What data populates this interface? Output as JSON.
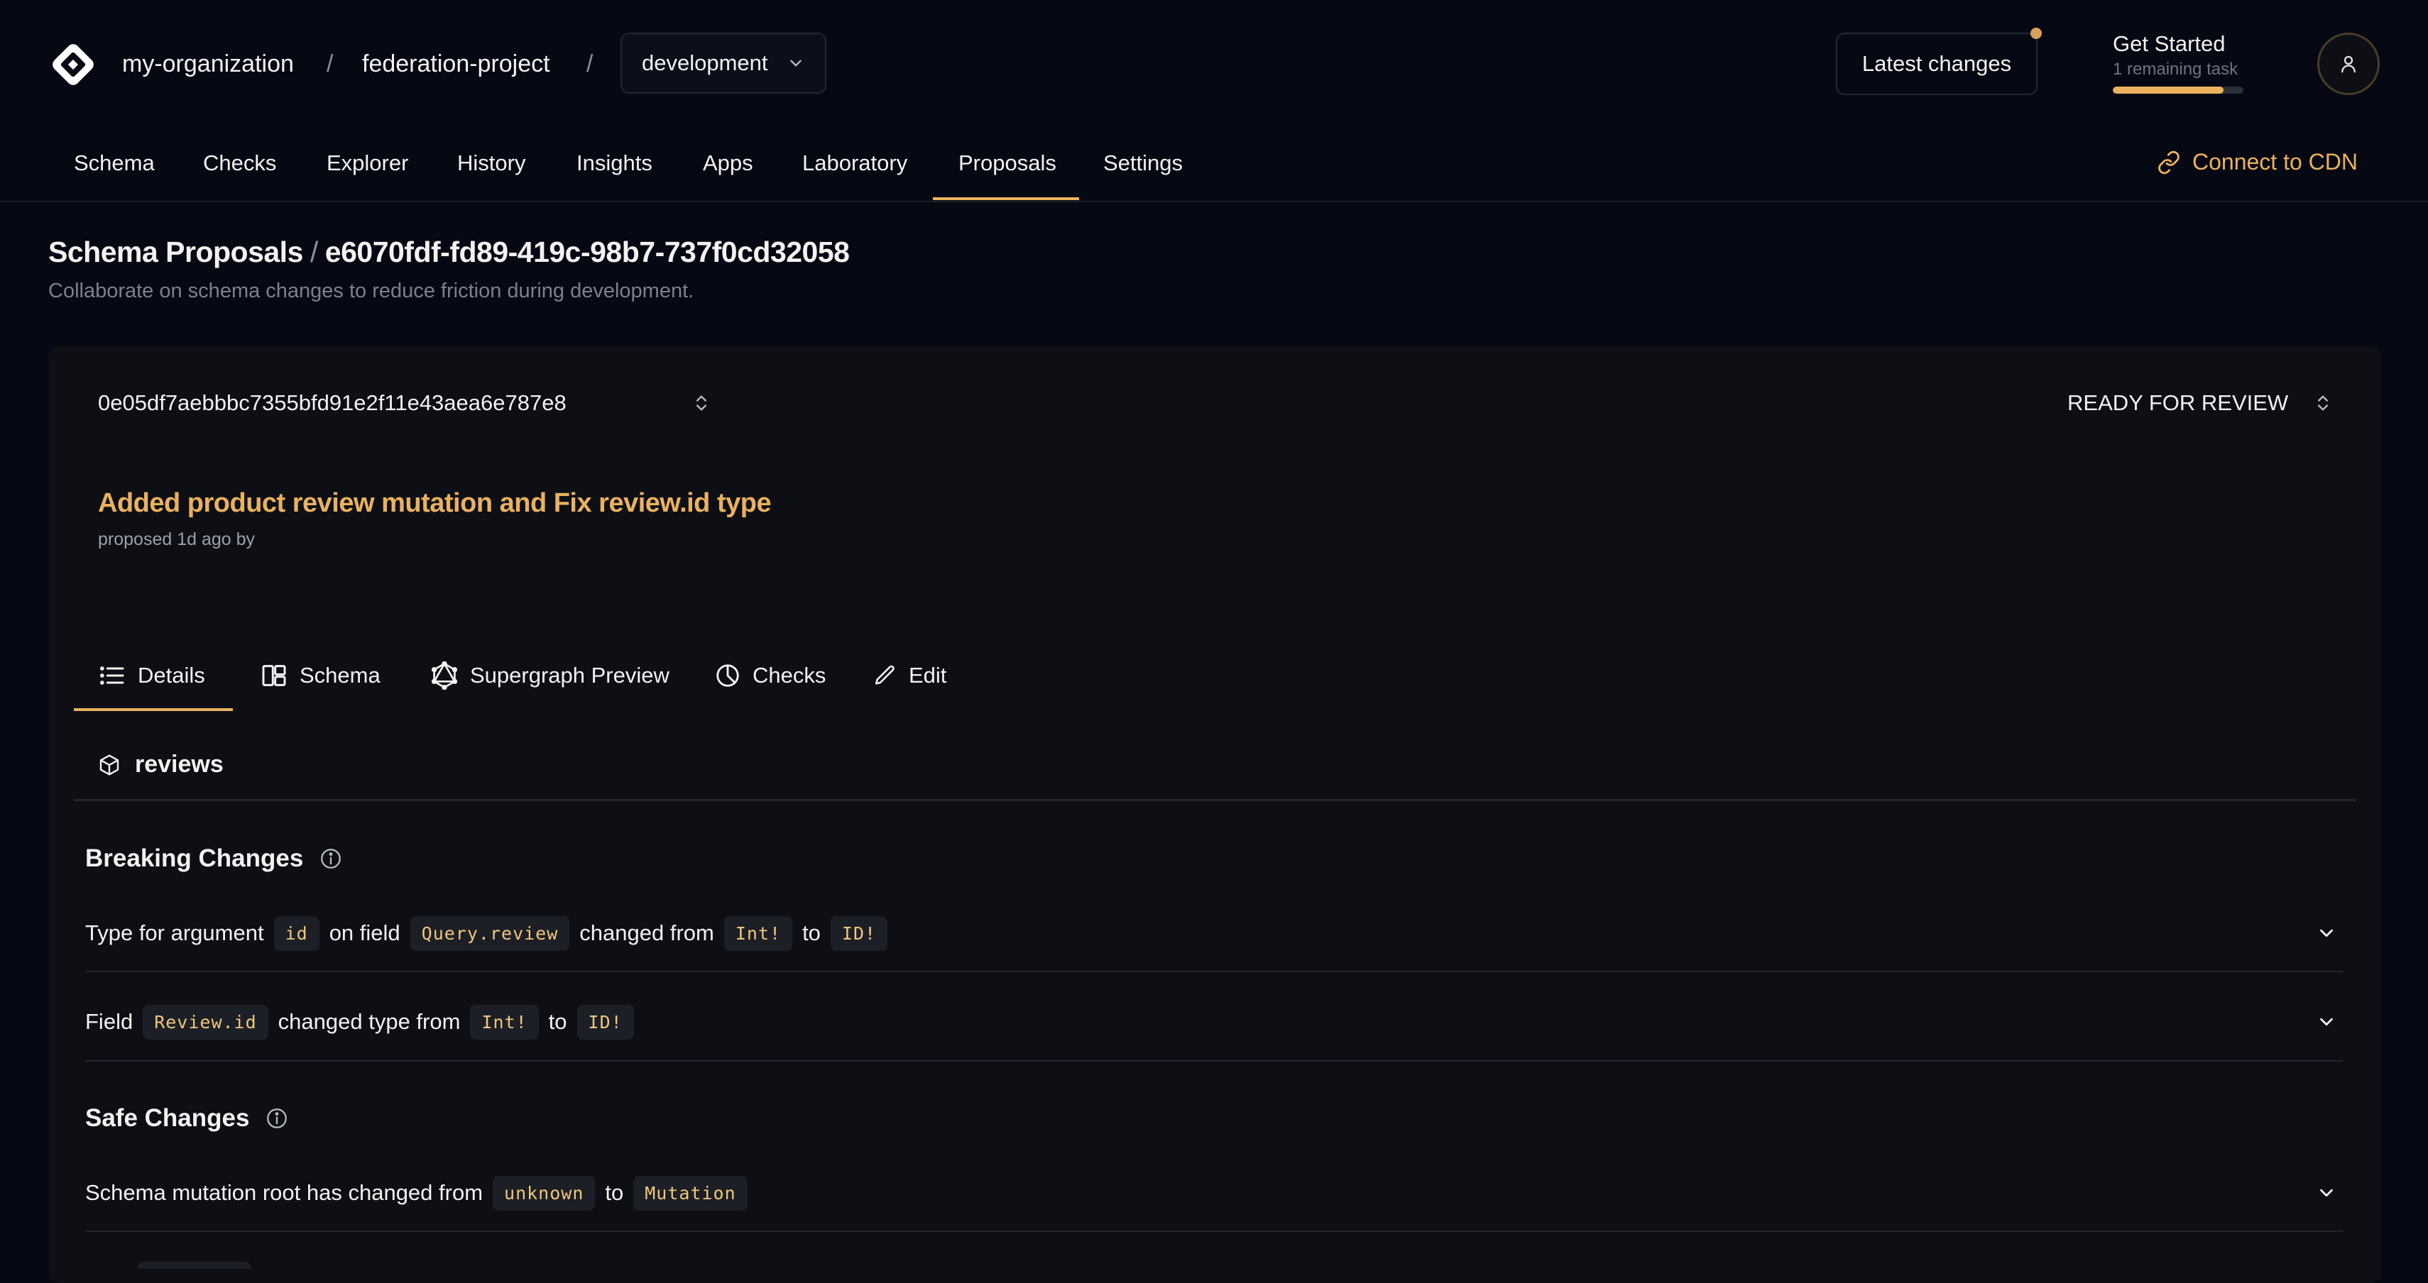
{
  "header": {
    "organization": "my-organization",
    "project": "federation-project",
    "target": "development",
    "latest_changes": "Latest changes",
    "get_started": {
      "title": "Get Started",
      "subtitle": "1 remaining task",
      "progress": 0.85
    }
  },
  "nav": {
    "items": [
      "Schema",
      "Checks",
      "Explorer",
      "History",
      "Insights",
      "Apps",
      "Laboratory",
      "Proposals",
      "Settings"
    ],
    "active": "Proposals",
    "cdn": "Connect to CDN"
  },
  "page": {
    "title": "Schema Proposals",
    "proposal_id": "e6070fdf-fd89-419c-98b7-737f0cd32058",
    "description": "Collaborate on schema changes to reduce friction during development."
  },
  "proposal": {
    "revision": "0e05df7aebbbc7355bfd91e2f11e43aea6e787e8",
    "status": "READY FOR REVIEW",
    "title": "Added product review mutation and Fix review.id type",
    "meta": "proposed 1d ago by"
  },
  "tabs": [
    {
      "label": "Details",
      "icon": "list-icon"
    },
    {
      "label": "Schema",
      "icon": "layout-icon"
    },
    {
      "label": "Supergraph Preview",
      "icon": "graphql-icon"
    },
    {
      "label": "Checks",
      "icon": "pie-chart-icon"
    },
    {
      "label": "Edit",
      "icon": "pencil-icon"
    }
  ],
  "active_tab": "Details",
  "service": {
    "name": "reviews",
    "icon": "box-icon"
  },
  "breaking_changes": {
    "title": "Breaking Changes",
    "rows": [
      {
        "t1": "Type for argument",
        "c1": "id",
        "t2": "on field",
        "c2": "Query.review",
        "t3": "changed from",
        "c3": "Int!",
        "t4": "to",
        "c4": "ID!"
      },
      {
        "t1": "Field",
        "c1": "Review.id",
        "t2": "changed type from",
        "c2": "Int!",
        "t3": "to",
        "c3": "ID!"
      }
    ]
  },
  "safe_changes": {
    "title": "Safe Changes",
    "rows": [
      {
        "t1": "Schema mutation root has changed from",
        "c1": "unknown",
        "t2": "to",
        "c2": "Mutation"
      }
    ]
  },
  "colors": {
    "accent": "#eab15f",
    "background": "#060913",
    "card": "#0d0f14",
    "code_text": "#eec77c"
  }
}
